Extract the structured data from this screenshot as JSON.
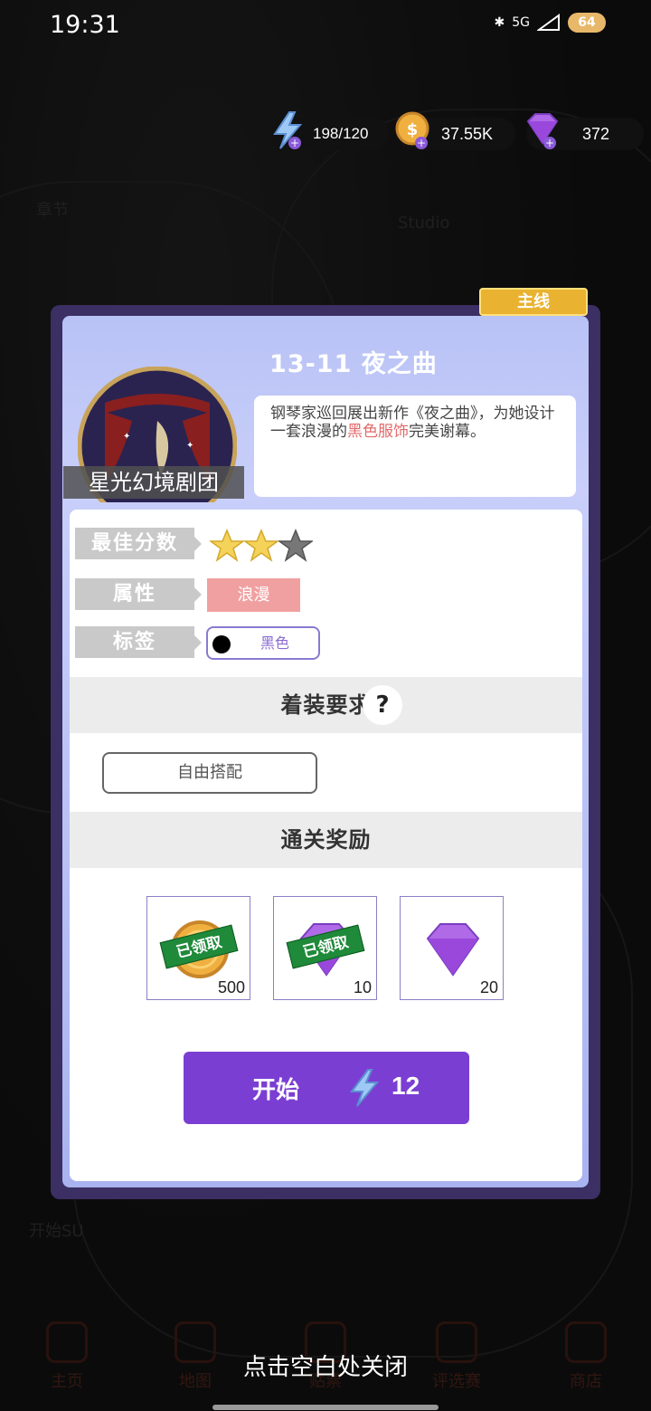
{
  "status_bar": {
    "time": "19:31",
    "network": "5G",
    "battery": "64"
  },
  "currencies": {
    "energy": {
      "value": "198/120",
      "icon": "lightning-icon"
    },
    "coins": {
      "value": "37.55K",
      "icon": "coin-icon"
    },
    "gems": {
      "value": "372",
      "icon": "gem-icon"
    }
  },
  "background": {
    "chapter_label": "章节",
    "studio_label": "Studio",
    "side_label": "开始SU"
  },
  "modal": {
    "badge": "主线",
    "stage_title": "13-11  夜之曲",
    "troupe_name": "星光幻境剧团",
    "description_before": "钢琴家巡回展出新作《夜之曲》，为她设计一套浪漫的",
    "description_highlight": "黑色服饰",
    "description_after": "完美谢幕。",
    "best_score_label": "最佳分数",
    "best_score_stars": 2,
    "max_stars": 3,
    "attribute_label": "属性",
    "attribute_value": "浪漫",
    "tag_label": "标签",
    "tag_value": "黑色",
    "dress_requirement_title": "着装要求",
    "help_symbol": "?",
    "free_match_label": "自由搭配",
    "rewards_title": "通关奖励",
    "rewards": [
      {
        "name": "coin",
        "count": "500",
        "claimed": true,
        "claimed_label": "已领取"
      },
      {
        "name": "gem",
        "count": "10",
        "claimed": true,
        "claimed_label": "已领取"
      },
      {
        "name": "gem",
        "count": "20",
        "claimed": false
      }
    ],
    "start_label": "开始",
    "start_cost": "12"
  },
  "bottom_nav": [
    "主页",
    "地图",
    "贴票",
    "评选赛",
    "商店"
  ],
  "close_hint": "点击空白处关闭",
  "colors": {
    "accent": "#7b3ed3",
    "badge": "#e9b230",
    "highlight": "#e26a6a",
    "attribute": "#f0a0a0"
  }
}
